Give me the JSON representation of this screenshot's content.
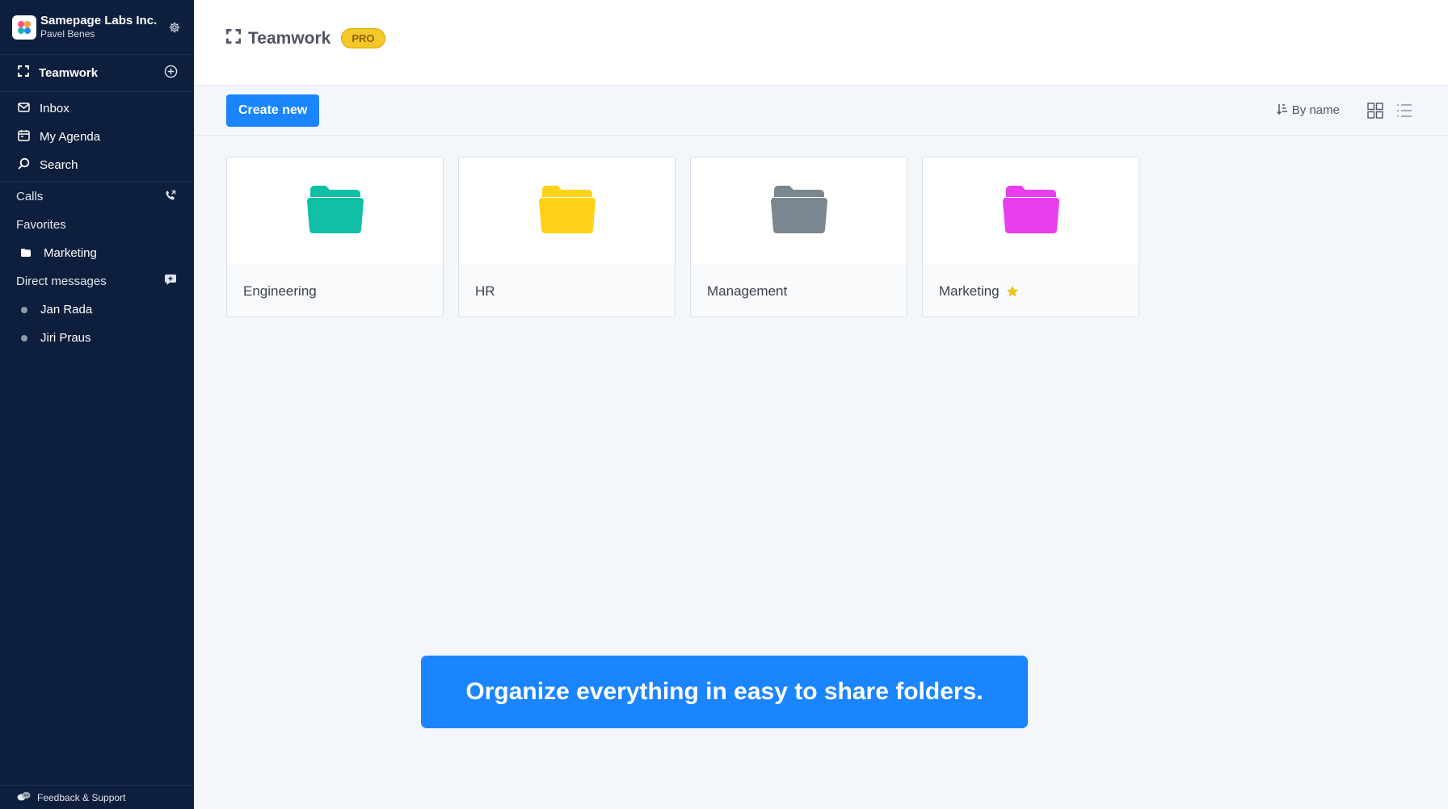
{
  "org": {
    "name": "Samepage Labs Inc.",
    "user": "Pavel Benes"
  },
  "sidebar": {
    "teamwork_label": "Teamwork",
    "nav": [
      {
        "label": "Inbox",
        "icon": "inbox-icon"
      },
      {
        "label": "My Agenda",
        "icon": "calendar-icon"
      },
      {
        "label": "Search",
        "icon": "search-icon"
      }
    ],
    "calls_label": "Calls",
    "favorites_label": "Favorites",
    "favorites": [
      {
        "label": "Marketing",
        "icon": "folder-icon"
      }
    ],
    "dm_label": "Direct messages",
    "dms": [
      {
        "label": "Jan Rada"
      },
      {
        "label": "Jiri Praus"
      }
    ],
    "feedback_label": "Feedback & Support"
  },
  "header": {
    "title": "Teamwork",
    "badge": "PRO"
  },
  "toolbar": {
    "create_label": "Create new",
    "sort_label": "By name"
  },
  "folders": [
    {
      "name": "Engineering",
      "color": "#10bfa5",
      "favorite": false
    },
    {
      "name": "HR",
      "color": "#ffd21a",
      "favorite": false
    },
    {
      "name": "Management",
      "color": "#7b878f",
      "favorite": false
    },
    {
      "name": "Marketing",
      "color": "#e83ef0",
      "favorite": true
    }
  ],
  "banner": {
    "text": "Organize everything in easy to share folders."
  },
  "colors": {
    "sidebar_bg": "#0e1f3d",
    "accent": "#1a85ff",
    "star": "#f0c419",
    "badge": "#f5c829"
  }
}
